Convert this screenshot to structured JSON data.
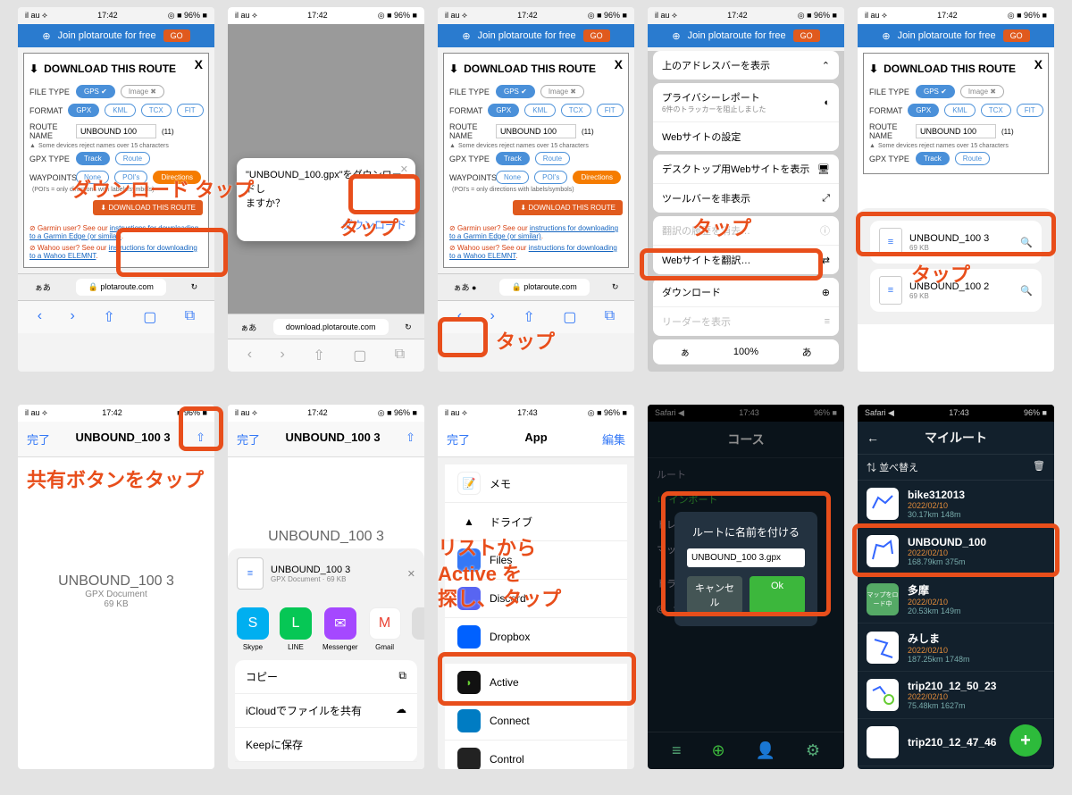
{
  "status": {
    "carrier": "il au ⟡",
    "time": "17:42",
    "time2": "17:43",
    "batt": "◎ ■ 96% ■"
  },
  "banner": {
    "text": "Join plotaroute for free",
    "go": "GO"
  },
  "panel": {
    "title": "DOWNLOAD THIS ROUTE",
    "fileType": "FILE TYPE",
    "gps": "GPS ✔",
    "image": "Image ✖",
    "format": "FORMAT",
    "gpx": "GPX",
    "kml": "KML",
    "tcx": "TCX",
    "fit": "FIT",
    "routeName": "ROUTE NAME",
    "name": "UNBOUND 100",
    "count": "(11)",
    "nameWarn": "Some devices reject names over 15 characters",
    "gpxType": "GPX TYPE",
    "track": "Track",
    "route": "Route",
    "waypoints": "WAYPOINTS",
    "none": "None",
    "pois": "POI's",
    "directions": "Directions",
    "wpNote": "(POI's = only directions with labels/symbols)",
    "dlBtn": "DOWNLOAD THIS ROUTE",
    "garmin_pre": "Garmin user? See our ",
    "garmin_link": "instructions for downloading to a Garmin Edge (or similar)",
    "wahoo_pre": "Wahoo user? See our ",
    "wahoo_link": "instructions for downloading to a Wahoo ELEMNT"
  },
  "safari": {
    "aa": "ぁあ",
    "url1": "plotaroute.com",
    "url2": "download.plotaroute.com",
    "refresh": "↻"
  },
  "dlDialog": {
    "msg1": "\"UNBOUND_100.gpx\"をダウンロードし",
    "msg2": "ますか？",
    "btn": "ダウンロード"
  },
  "aaMenu": {
    "rows": [
      "上のアドレスバーを表示",
      "プライバシーレポート",
      "Webサイトの設定",
      "デスクトップ用Webサイトを表示",
      "ツールバーを非表示",
      "翻訳の履歴を消去…",
      "Webサイトを翻訳…",
      "ダウンロード",
      "リーダーを表示"
    ],
    "privacySub": "6件のトラッカーを阻止しました",
    "zoom": "100%",
    "a1": "ぁ",
    "a2": "あ"
  },
  "files": [
    {
      "name": "UNBOUND_100 3",
      "size": "69 KB"
    },
    {
      "name": "UNBOUND_100 2",
      "size": "69 KB"
    }
  ],
  "preview": {
    "done": "完了",
    "title": "UNBOUND_100 3",
    "doc": "GPX Document",
    "size": "69 KB"
  },
  "shareSheet": {
    "fileTitle": "UNBOUND_100 3",
    "fileSub": "GPX Document · 69 KB",
    "icons": [
      {
        "l": "Skype",
        "c": "#00aff0"
      },
      {
        "l": "LINE",
        "c": "#06c755"
      },
      {
        "l": "Messenger",
        "c": "#a548ff"
      },
      {
        "l": "Gmail",
        "c": "#ea4335"
      }
    ],
    "actions": [
      "コピー",
      "iCloudでファイルを共有",
      "Keepに保存"
    ]
  },
  "appPicker": {
    "done": "完了",
    "title": "App",
    "edit": "編集",
    "apps": [
      {
        "n": "メモ",
        "c": "#ffd54a"
      },
      {
        "n": "ドライブ",
        "c": "#34a853"
      },
      {
        "n": "Files",
        "c": "#3478f6"
      },
      {
        "n": "Discord",
        "c": "#5865f2"
      },
      {
        "n": "Dropbox",
        "c": "#0061ff"
      },
      {
        "n": "Active",
        "c": "#111"
      },
      {
        "n": "Connect",
        "c": "#007cc3"
      },
      {
        "n": "Control",
        "c": "#222"
      }
    ]
  },
  "bryton1": {
    "title": "コース",
    "sections": [
      "ルート",
      "インポート",
      "トレーナー",
      "マップ",
      "トラッキング",
      "ライブトラック"
    ],
    "modalTitle": "ルートに名前を付ける",
    "modalValue": "UNBOUND_100 3.gpx",
    "cancel": "キャンセル",
    "ok": "Ok"
  },
  "bryton2": {
    "title": "マイルート",
    "sort": "並べ替え",
    "routes": [
      {
        "n": "bike312013",
        "d": "2022/02/10",
        "s": "30.17km 148m"
      },
      {
        "n": "UNBOUND_100",
        "d": "2022/02/10",
        "s": "168.79km 375m"
      },
      {
        "n": "多摩",
        "d": "2022/02/10",
        "s": "20.53km 149m"
      },
      {
        "n": "みしま",
        "d": "2022/02/10",
        "s": "187.25km 1748m"
      },
      {
        "n": "trip210_12_50_23",
        "d": "2022/02/10",
        "s": "75.48km 1627m"
      },
      {
        "n": "trip210_12_47_46",
        "d": "",
        "s": ""
      }
    ],
    "thumbLabel": "マップをロード中"
  },
  "annotations": {
    "a1": "ダウンロード タップ",
    "a2": "タップ",
    "a3": "タップ",
    "a4": "タップ",
    "a5": "タップ",
    "a6": "共有ボタンをタップ",
    "a7_1": "リストから",
    "a7_2": "Active を",
    "a7_3": "探し、 タップ"
  }
}
